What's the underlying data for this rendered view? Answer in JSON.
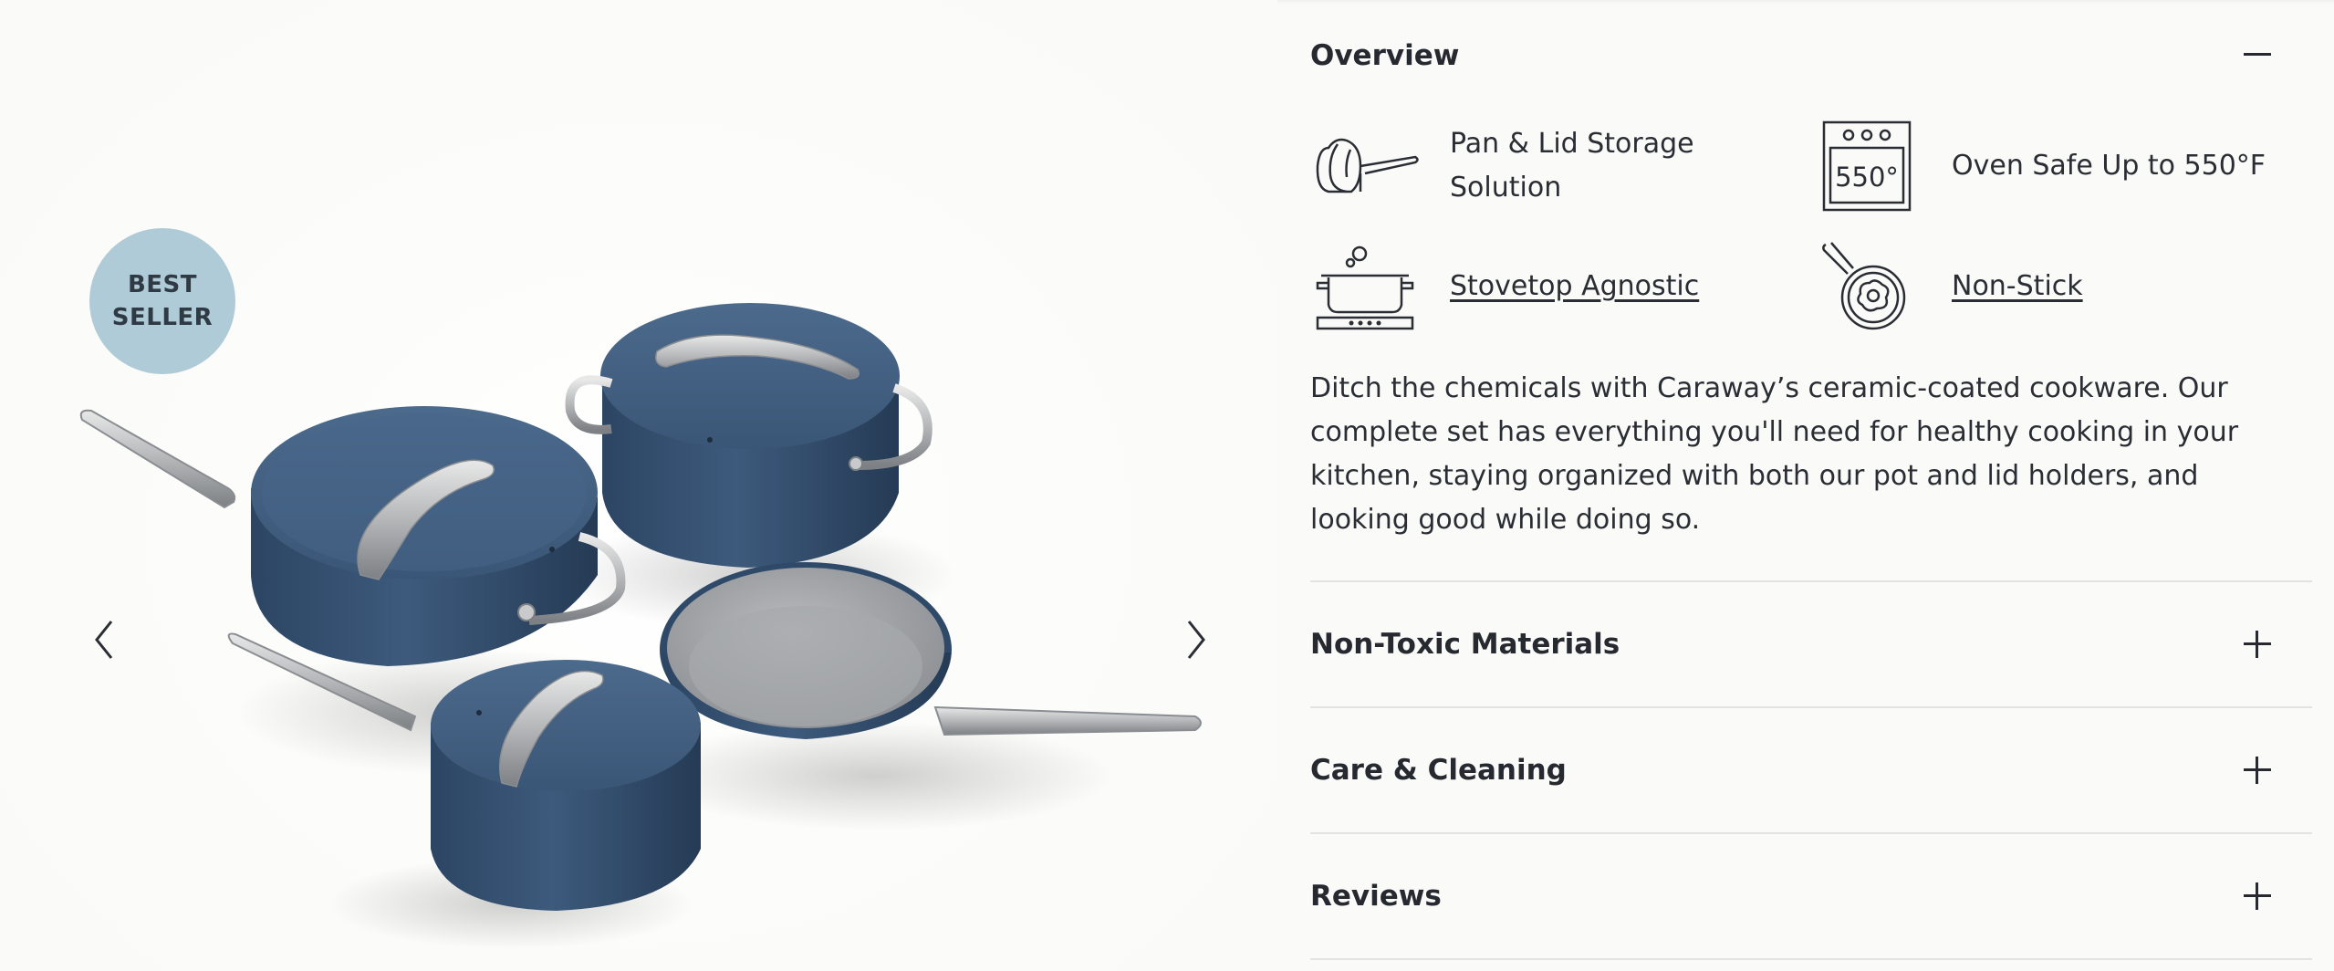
{
  "badge": {
    "line1": "BEST",
    "line2": "SELLER"
  },
  "gallery": {
    "prev_icon": "chevron-left-icon",
    "next_icon": "chevron-right-icon",
    "product_image": "cookware-set-navy-image"
  },
  "accordion": {
    "overview": {
      "title": "Overview",
      "toggle_icon": "minus-icon",
      "features": [
        {
          "label_line1": "Pan & Lid Storage",
          "label_line2": "Solution",
          "icon": "pan-lid-storage-icon"
        },
        {
          "label": "Oven Safe Up to 550°F",
          "icon": "oven-550-icon",
          "icon_text": "550°"
        },
        {
          "label": "Stovetop Agnostic",
          "icon": "stovetop-pot-icon"
        },
        {
          "label": "Non-Stick",
          "icon": "frying-pan-egg-icon"
        }
      ],
      "description": "Ditch the chemicals with Caraway’s ceramic-coated cookware. Our complete set has everything you'll need for healthy cooking in your kitchen, staying organized with both our pot and lid holders, and looking good while doing so."
    },
    "sections": [
      {
        "title": "Non-Toxic Materials",
        "toggle_icon": "plus-icon"
      },
      {
        "title": "Care & Cleaning",
        "toggle_icon": "plus-icon"
      },
      {
        "title": "Reviews",
        "toggle_icon": "plus-icon"
      }
    ]
  },
  "colors": {
    "background": "#fafaf8",
    "badge": "#aecbd7",
    "pan_navy": "#3f5c7d",
    "text": "#2a2d33",
    "divider": "#e3e3e0"
  }
}
